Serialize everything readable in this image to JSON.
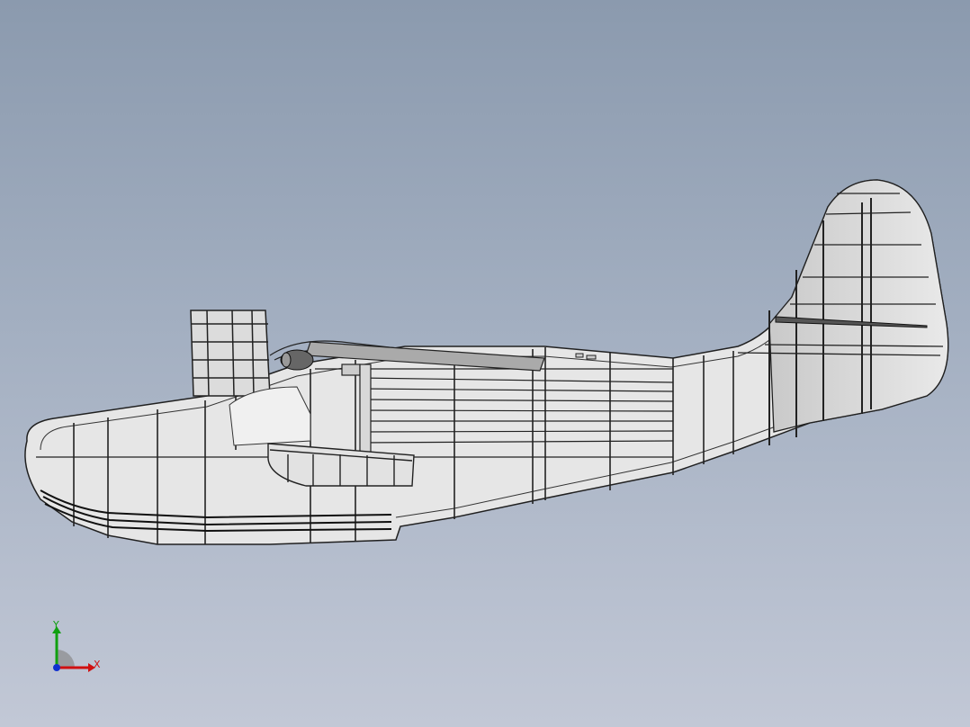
{
  "viewport": {
    "background_top": "#8b9aae",
    "background_bottom": "#c2c8d6",
    "model": "seaplane-hull-frame-wireframe",
    "display_mode": "shaded-with-edges"
  },
  "triad": {
    "x_label": "X",
    "y_label": "Y",
    "x_color": "#d01010",
    "y_color": "#10a010",
    "z_color": "#1030d0"
  }
}
